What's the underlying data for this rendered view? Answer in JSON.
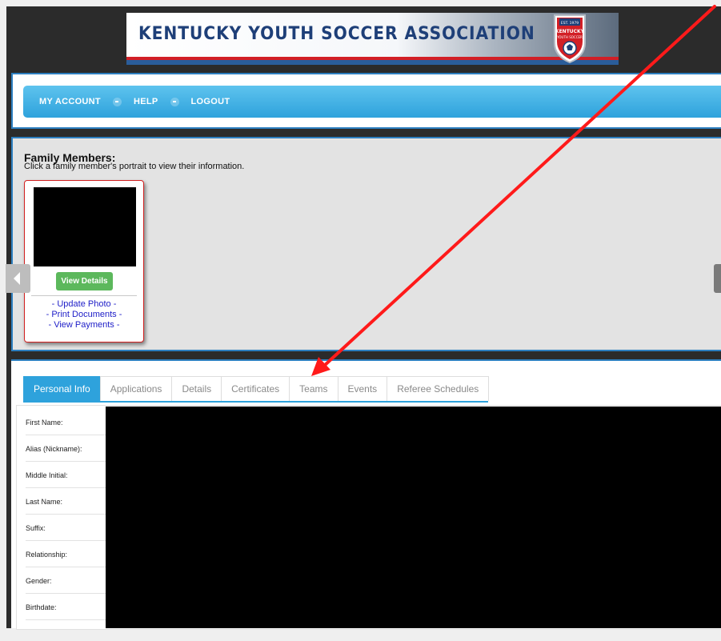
{
  "header": {
    "title": "KENTUCKY YOUTH SOCCER ASSOCIATION",
    "crest": {
      "top_text": "EST. 1979",
      "main_text": "KENTUCKY",
      "sub_text": "YOUTH SOCCER"
    }
  },
  "nav": {
    "items": [
      {
        "label": "MY ACCOUNT"
      },
      {
        "label": "HELP"
      },
      {
        "label": "LOGOUT"
      }
    ]
  },
  "family": {
    "title": "Family Members:",
    "subtitle": "Click a family member's portrait to view their information.",
    "card": {
      "button_label": "View Details",
      "links": [
        "- Update Photo -",
        "- Print Documents -",
        "- View Payments -"
      ]
    }
  },
  "tabs": [
    {
      "label": "Personal Info",
      "active": true
    },
    {
      "label": "Applications",
      "active": false
    },
    {
      "label": "Details",
      "active": false
    },
    {
      "label": "Certificates",
      "active": false
    },
    {
      "label": "Teams",
      "active": false
    },
    {
      "label": "Events",
      "active": false
    },
    {
      "label": "Referee Schedules",
      "active": false
    }
  ],
  "fields": [
    "First Name:",
    "Alias (Nickname):",
    "Middle Initial:",
    "Last Name:",
    "Suffix:",
    "Relationship:",
    "Gender:",
    "Birthdate:"
  ],
  "colors": {
    "brand_blue": "#2ea2dc",
    "frame_dark": "#2b2b2b",
    "annotation_red": "#ff0000",
    "button_green": "#5cb85c",
    "link_blue": "#2020c8"
  },
  "annotation": {
    "type": "arrow",
    "color": "#ff0000",
    "points_to": "Teams"
  }
}
